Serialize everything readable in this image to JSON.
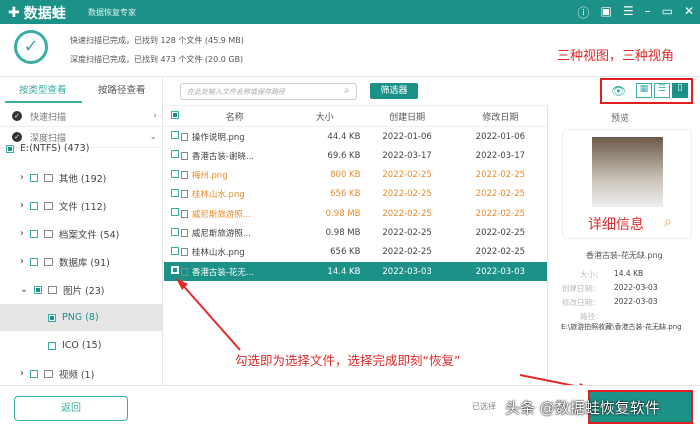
{
  "app": {
    "name": "数据蛙",
    "subtitle": "数据恢复专家"
  },
  "header": {
    "quick_scan": "快速扫描已完成，已找到 128 个文件 (45.9 MB)",
    "deep_scan": "深度扫描已完成，已找到 473 个文件 (20.0 GB)"
  },
  "left": {
    "tabs": [
      "按类型查看",
      "按路径查看"
    ],
    "quick": "快速扫描",
    "deep": "深度扫描",
    "drive": "E:(NTFS) (473)",
    "tree": [
      {
        "label": "其他 (192)"
      },
      {
        "label": "文件 (112)"
      },
      {
        "label": "档案文件 (54)"
      },
      {
        "label": "数据库 (91)"
      },
      {
        "label": "图片 (23)"
      },
      {
        "label": "PNG (8)"
      },
      {
        "label": "ICO (15)"
      },
      {
        "label": "视频 (1)"
      }
    ]
  },
  "search": {
    "placeholder": "在此处输入文件名称或保存路径"
  },
  "filter_label": "筛选器",
  "table": {
    "headers": [
      "名称",
      "大小",
      "创建日期",
      "修改日期"
    ],
    "rows": [
      [
        "操作说明.png",
        "44.4 KB",
        "2022-01-06",
        "2022-01-06"
      ],
      [
        "香港古装-谢晓...",
        "69.6 KB",
        "2022-03-17",
        "2022-03-17"
      ],
      [
        "梅州.png",
        "800 KB",
        "2022-02-25",
        "2022-02-25"
      ],
      [
        "桂林山水.png",
        "656 KB",
        "2022-02-25",
        "2022-02-25"
      ],
      [
        "威尼斯旅游照...",
        "0.98 MB",
        "2022-02-25",
        "2022-02-25"
      ],
      [
        "威尼斯旅游照...",
        "0.98 MB",
        "2022-02-25",
        "2022-02-25"
      ],
      [
        "桂林山水.png",
        "656 KB",
        "2022-02-25",
        "2022-02-25"
      ],
      [
        "香港古装-花无...",
        "14.4 KB",
        "2022-03-03",
        "2022-03-03"
      ]
    ]
  },
  "preview": {
    "title": "预览",
    "filename": "香港古装-花无缺.png",
    "size_label": "大小：",
    "size": "14.4 KB",
    "created_label": "创建日期：",
    "created": "2022-03-03",
    "modified_label": "修改日期：",
    "modified": "2022-03-03",
    "path_label": "路径：",
    "path": "E:\\旅游拍照收藏\\香港古装-花无缺.png"
  },
  "footer": {
    "back": "返回",
    "selected": "已选择"
  },
  "annotations": {
    "views": "三种视图，三种视角",
    "details": "详细信息",
    "select": "勾选即为选择文件，选择完成即刻“恢复”",
    "watermark": "头条 @数据蛙恢复软件"
  },
  "colors": {
    "accent": "#1b9188",
    "annotation": "#e02a2a",
    "highlight": "#e88b2c"
  }
}
